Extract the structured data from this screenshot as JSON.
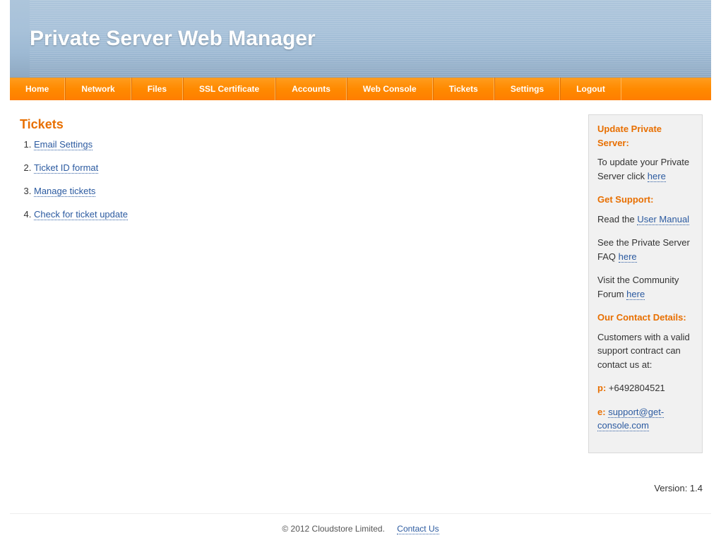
{
  "header": {
    "title": "Private Server Web Manager"
  },
  "nav": {
    "items": [
      "Home",
      "Network",
      "Files",
      "SSL Certificate",
      "Accounts",
      "Web Console",
      "Tickets",
      "Settings",
      "Logout"
    ]
  },
  "main": {
    "heading": "Tickets",
    "links": [
      "Email Settings",
      "Ticket ID format",
      "Manage tickets",
      "Check for ticket update"
    ]
  },
  "sidebar": {
    "update": {
      "heading": "Update Private Server:",
      "text_a": "To update your Private Server click ",
      "link": "here"
    },
    "support": {
      "heading": "Get Support:",
      "row1_a": "Read the ",
      "row1_link": "User Manual",
      "row2_a": "See the Private Server FAQ ",
      "row2_link": "here",
      "row3_a": "Visit the Community Forum ",
      "row3_link": "here"
    },
    "contact": {
      "heading": "Our Contact Details:",
      "intro": "Customers with a valid support contract can contact us at:",
      "phone_label": "p:",
      "phone": " +6492804521",
      "email_label": "e:",
      "email": "support@get-console.com"
    }
  },
  "version": "Version: 1.4",
  "footer": {
    "copyright": "© 2012 Cloudstore Limited.",
    "contact": "Contact Us"
  }
}
